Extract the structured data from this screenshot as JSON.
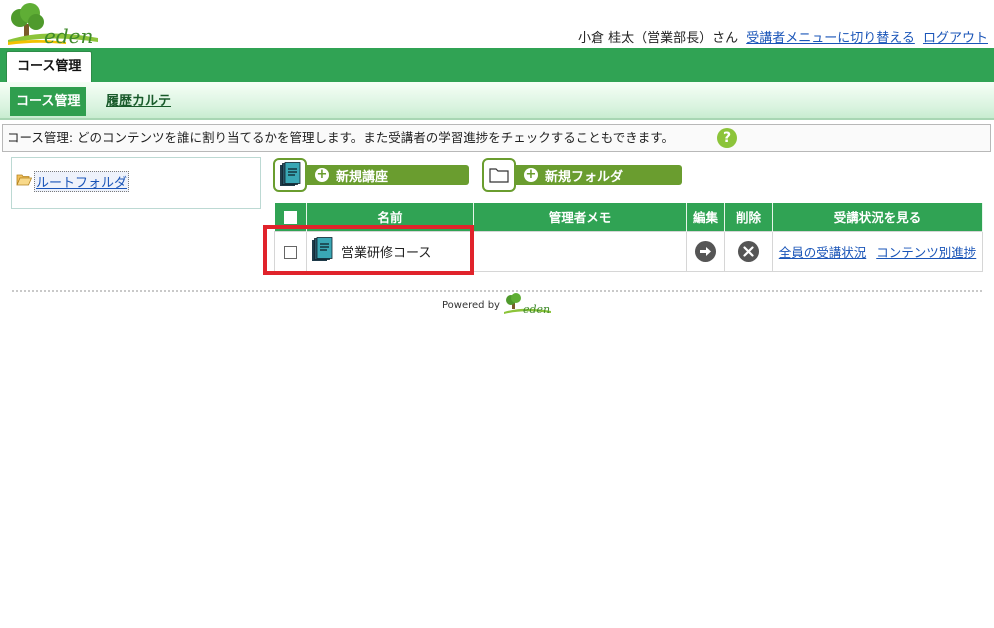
{
  "header": {
    "user_name": "小倉 桂太（営業部長）さん",
    "switch_link": "受講者メニューに切り替える",
    "logout_link": "ログアウト"
  },
  "tabs": {
    "main": "コース管理",
    "sub_active": "コース管理",
    "sub_other": "履歴カルテ"
  },
  "description": "コース管理: どのコンテンツを誰に割り当てるかを管理します。また受講者の学習進捗をチェックすることもできます。",
  "tree": {
    "root": "ルートフォルダ"
  },
  "toolbar": {
    "new_course": "新規講座",
    "new_folder": "新規フォルダ"
  },
  "table": {
    "headers": [
      "名前",
      "管理者メモ",
      "編集",
      "削除",
      "受講状況を見る"
    ],
    "rows": [
      {
        "name": "営業研修コース",
        "memo": "",
        "link_all": "全員の受講状況",
        "link_progress": "コンテンツ別進捗"
      }
    ]
  },
  "footer": {
    "powered_by": "Powered by"
  },
  "brand": {
    "logo_text": "eden"
  },
  "colors": {
    "brand_green": "#30a354",
    "button_green": "#6a9d2f",
    "highlight_red": "#e0232b",
    "link_blue": "#1a55b8"
  }
}
